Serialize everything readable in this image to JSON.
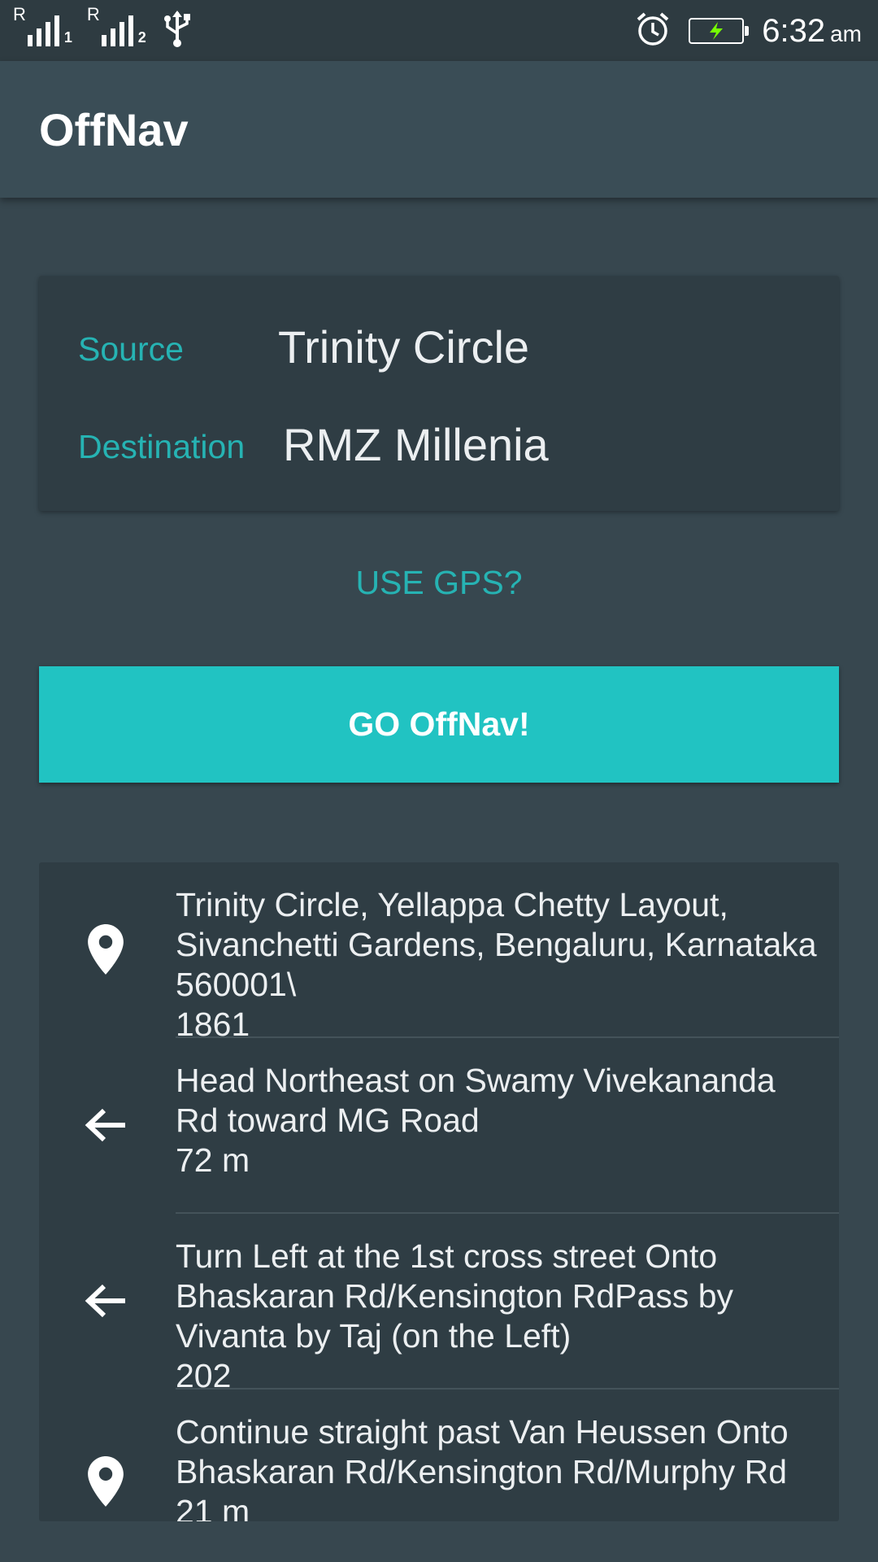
{
  "status_bar": {
    "sim1_label": "1",
    "sim2_label": "2",
    "time": "6:32",
    "ampm": "am",
    "icons": [
      "signal-sim1-icon",
      "signal-sim2-icon",
      "usb-icon",
      "alarm-icon",
      "battery-charging-icon"
    ],
    "battery_bolt_color": "#76ff03"
  },
  "app_bar": {
    "title": "OffNav"
  },
  "route_form": {
    "source_label": "Source",
    "source_value": "Trinity Circle",
    "destination_label": "Destination",
    "destination_value": "RMZ Millenia"
  },
  "gps_button": "USE GPS?",
  "go_button": "GO OffNav!",
  "directions": [
    {
      "icon": "location-pin-icon",
      "line1": "Trinity Circle, Yellappa Chetty Layout,",
      "line2": "Sivanchetti Gardens, Bengaluru, Karnataka",
      "line3": "560001\\",
      "line4": "1861"
    },
    {
      "icon": "arrow-left-icon",
      "line1": "Head Northeast on Swamy Vivekananda",
      "line2": "Rd toward MG Road",
      "line3": "72 m",
      "line4": ""
    },
    {
      "icon": "arrow-left-icon",
      "line1": "Turn Left at the 1st cross street Onto",
      "line2": "Bhaskaran Rd/Kensington RdPass by",
      "line3": "Vivanta by Taj (on the Left)",
      "line4": "202"
    },
    {
      "icon": "location-pin-icon",
      "line1": "Continue straight past Van Heussen Onto",
      "line2": "Bhaskaran Rd/Kensington Rd/Murphy Rd",
      "line3": "21 m",
      "line4": ""
    }
  ],
  "colors": {
    "accent": "#21c3c2",
    "label": "#26b3b3",
    "background": "#37474f",
    "card": "#2f3d44",
    "toolbar": "#3a4d56",
    "status_bar": "#2e3b41"
  }
}
